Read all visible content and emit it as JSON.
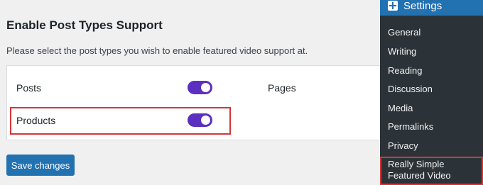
{
  "section": {
    "title": "Enable Post Types Support",
    "description": "Please select the post types you wish to enable featured video support at."
  },
  "post_types": [
    {
      "label": "Posts",
      "enabled": true
    },
    {
      "label": "Pages",
      "enabled": null
    },
    {
      "label": "Products",
      "enabled": true
    }
  ],
  "save_label": "Save changes",
  "sidebar": {
    "menu_title": "Settings",
    "menu_icon": "settings-icon",
    "items": [
      {
        "label": "General"
      },
      {
        "label": "Writing"
      },
      {
        "label": "Reading"
      },
      {
        "label": "Discussion"
      },
      {
        "label": "Media"
      },
      {
        "label": "Permalinks"
      },
      {
        "label": "Privacy"
      },
      {
        "label": "Really Simple Featured Video"
      }
    ]
  },
  "colors": {
    "toggle_on": "#5b2fbf",
    "primary_button": "#2271b1",
    "sidebar_bg": "#2c3338",
    "highlight": "#d63638"
  }
}
